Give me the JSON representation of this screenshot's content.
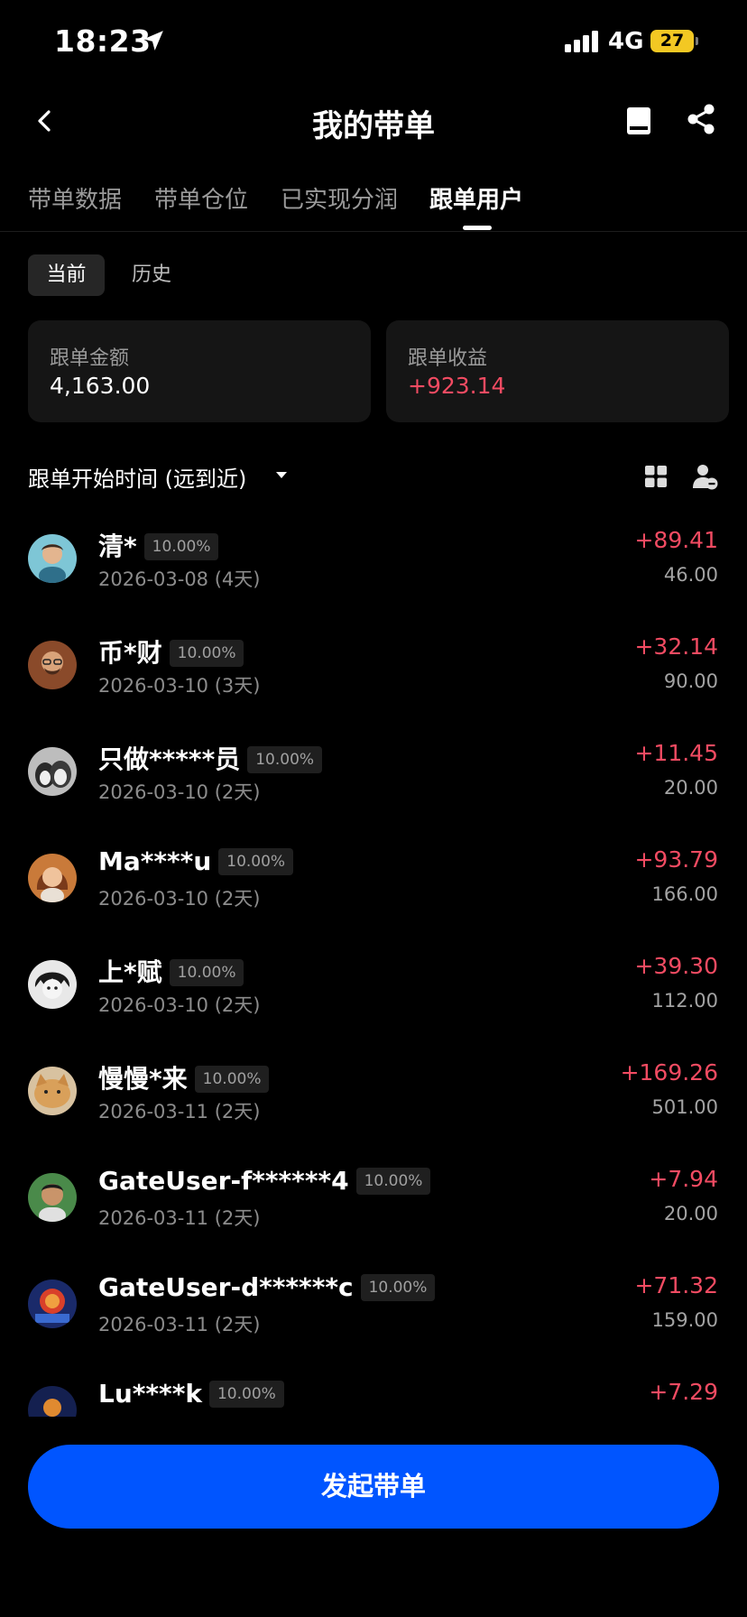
{
  "status_bar": {
    "time": "18:23",
    "network": "4G",
    "battery": "27"
  },
  "header": {
    "title": "我的带单"
  },
  "tabs": [
    "带单数据",
    "带单仓位",
    "已实现分润",
    "跟单用户"
  ],
  "active_tab": 3,
  "segments": {
    "current": "当前",
    "history": "历史"
  },
  "summary": {
    "amount_label": "跟单金额",
    "amount_value": "4,163.00",
    "profit_label": "跟单收益",
    "profit_value": "+923.14"
  },
  "sort": {
    "label": "跟单开始时间 (远到近)"
  },
  "followers": [
    {
      "name": "清*",
      "pct": "10.00%",
      "date": "2026-03-08 (4天)",
      "profit": "+89.41",
      "amount": "46.00"
    },
    {
      "name": "币*财",
      "pct": "10.00%",
      "date": "2026-03-10 (3天)",
      "profit": "+32.14",
      "amount": "90.00"
    },
    {
      "name": "只做*****员",
      "pct": "10.00%",
      "date": "2026-03-10 (2天)",
      "profit": "+11.45",
      "amount": "20.00"
    },
    {
      "name": "Ma****u",
      "pct": "10.00%",
      "date": "2026-03-10 (2天)",
      "profit": "+93.79",
      "amount": "166.00"
    },
    {
      "name": "上*赋",
      "pct": "10.00%",
      "date": "2026-03-10 (2天)",
      "profit": "+39.30",
      "amount": "112.00"
    },
    {
      "name": "慢慢*来",
      "pct": "10.00%",
      "date": "2026-03-11 (2天)",
      "profit": "+169.26",
      "amount": "501.00"
    },
    {
      "name": "GateUser-f******4",
      "pct": "10.00%",
      "date": "2026-03-11 (2天)",
      "profit": "+7.94",
      "amount": "20.00"
    },
    {
      "name": "GateUser-d******c",
      "pct": "10.00%",
      "date": "2026-03-11 (2天)",
      "profit": "+71.32",
      "amount": "159.00"
    },
    {
      "name": "Lu****k",
      "pct": "10.00%",
      "date": "",
      "profit": "+7.29",
      "amount": ""
    }
  ],
  "cta": {
    "label": "发起带单"
  },
  "colors": {
    "positive": "#f24b62",
    "primary": "#0055ff",
    "background": "#000000"
  }
}
